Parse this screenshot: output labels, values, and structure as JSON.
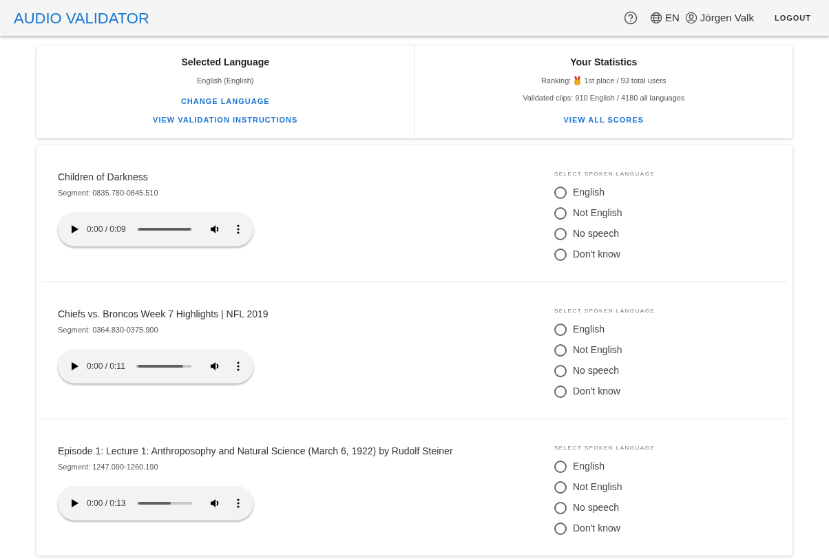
{
  "app_bar": {
    "title": "AUDIO VALIDATOR",
    "language": "EN",
    "user": "Jörgen Valk",
    "logout": "LOGOUT"
  },
  "language_card": {
    "title": "Selected Language",
    "language": "English (English)",
    "change_link": "CHANGE LANGUAGE",
    "instructions_link": "VIEW VALIDATION INSTRUCTIONS"
  },
  "stats_card": {
    "title": "Your Statistics",
    "ranking_label": "Ranking:",
    "ranking": "1st place / 93 total users",
    "clips": "Validated clips: 910 English / 4180 all languages",
    "scores_link": "VIEW ALL SCORES"
  },
  "clips": [
    {
      "title": "Children of Darkness",
      "segment": "Segment: 0835.780-0845.510",
      "time": "0:00 / 0:09",
      "level": 1.0,
      "group_label": "SELECT SPOKEN LANGUAGE",
      "options": [
        {
          "label": "English",
          "selected": false
        },
        {
          "label": "Not English",
          "selected": false
        },
        {
          "label": "No speech",
          "selected": false
        },
        {
          "label": "Don't know",
          "selected": false
        }
      ]
    },
    {
      "title": "Chiefs vs. Broncos Week 7 Highlights | NFL 2019",
      "segment": "Segment: 0364.830-0375.900",
      "time": "0:00 / 0:11",
      "level": 0.87,
      "group_label": "SELECT SPOKEN LANGUAGE",
      "options": [
        {
          "label": "English",
          "selected": false
        },
        {
          "label": "Not English",
          "selected": false
        },
        {
          "label": "No speech",
          "selected": false
        },
        {
          "label": "Don't know",
          "selected": false
        }
      ]
    },
    {
      "title": "Episode 1: Lecture 1: Anthroposophy and Natural Science (March 6, 1922) by Rudolf Steiner",
      "segment": "Segment: 1247.090-1260.190",
      "time": "0:00 / 0:13",
      "level": 0.62,
      "group_label": "SELECT SPOKEN LANGUAGE",
      "options": [
        {
          "label": "English",
          "selected": false
        },
        {
          "label": "Not English",
          "selected": false
        },
        {
          "label": "No speech",
          "selected": false
        },
        {
          "label": "Don't know",
          "selected": false
        }
      ]
    }
  ]
}
